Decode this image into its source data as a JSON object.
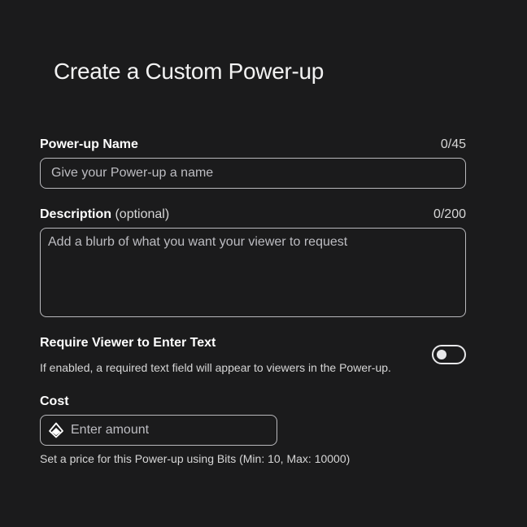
{
  "page": {
    "title": "Create a Custom Power-up"
  },
  "name_field": {
    "label": "Power-up Name",
    "counter": "0/45",
    "placeholder": "Give your Power-up a name",
    "value": ""
  },
  "description_field": {
    "label": "Description",
    "optional": "(optional)",
    "counter": "0/200",
    "placeholder": "Add a blurb of what you want your viewer to request",
    "value": ""
  },
  "require_text": {
    "label": "Require Viewer to Enter Text",
    "hint": "If enabled, a required text field will appear to viewers in the Power-up.",
    "enabled": false
  },
  "cost_field": {
    "label": "Cost",
    "placeholder": "Enter amount",
    "value": "",
    "icon": "bits-icon",
    "hint": "Set a price for this Power-up using Bits (Min: 10, Max: 10000)"
  },
  "colors": {
    "background": "#1b1b1c",
    "border": "#b9b9bd",
    "text": "#ffffff",
    "muted_text": "#d6d6d6"
  }
}
